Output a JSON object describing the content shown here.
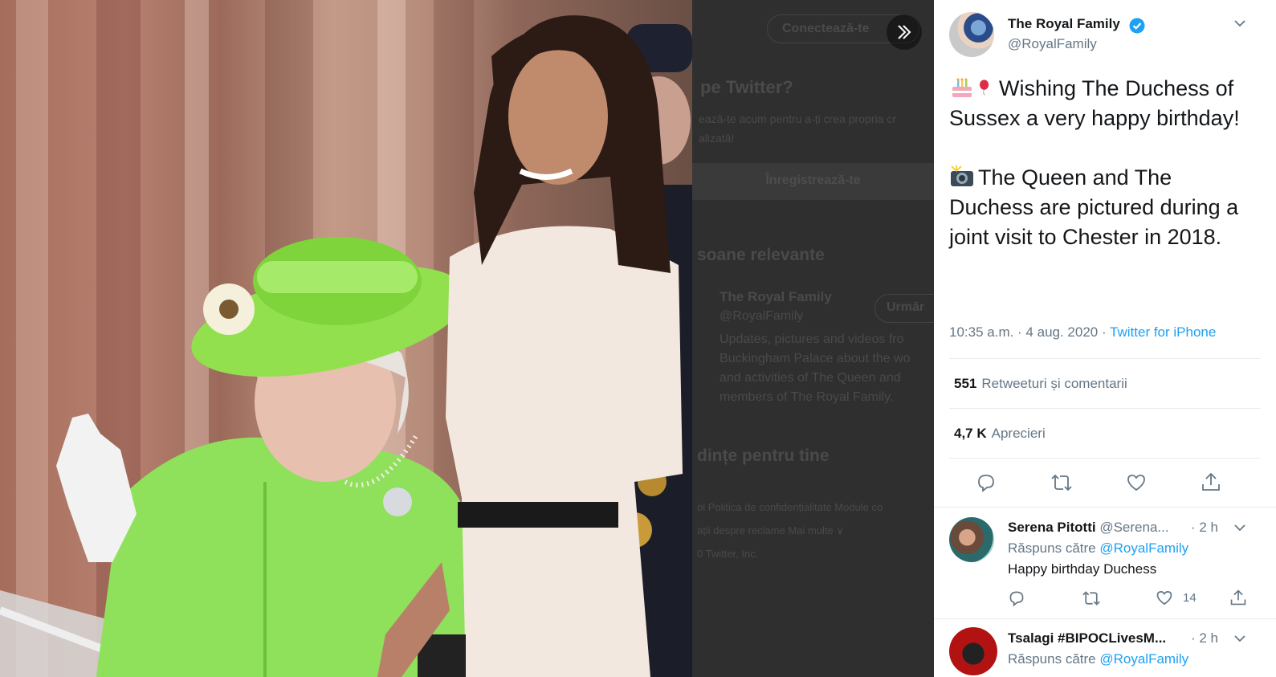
{
  "overlay": {
    "login_button": "Conectează-te",
    "new_to_twitter": "pe Twitter?",
    "signup_blurb_1": "ează-te acum pentru a-ți crea propria cr",
    "signup_blurb_2": "alizată!",
    "signup_button": "Înregistrează-te",
    "relevant_people": "soane relevante",
    "suggest_name": "The Royal Family",
    "suggest_handle": "@RoyalFamily",
    "follow_button": "Urmăr",
    "bio_1": "Updates, pictures and videos fro",
    "bio_2": "Buckingham Palace about the wo",
    "bio_3": "and activities of The Queen and",
    "bio_4": "members of The Royal Family.",
    "trends": "dințe pentru tine",
    "footer_1": "ol   Politica de confidențialitate   Module co",
    "footer_2": "ații despre reclame   Mai multe ∨",
    "footer_3": "0 Twitter, Inc."
  },
  "tweet": {
    "author_name": "The Royal Family",
    "author_handle": "@RoyalFamily",
    "line1": "Wishing The Duchess of Sussex a very happy birthday!",
    "line2": "The Queen and The Duchess are pictured during a joint visit to Chester in 2018.",
    "time": "10:35 a.m. · 4 aug. 2020 · ",
    "source": "Twitter for iPhone",
    "retweets_count": "551",
    "retweets_label": "Retweeturi și comentarii",
    "likes_count": "4,7 K",
    "likes_label": "Aprecieri"
  },
  "replies": [
    {
      "name": "Serena Pitotti",
      "handle": "@Serena...",
      "time": "· 2 h",
      "reply_to_label": "Răspuns către",
      "reply_to": "@RoyalFamily",
      "body": "Happy birthday Duchess",
      "likes": "14"
    },
    {
      "name": "Tsalagi #BIPOCLivesM...",
      "handle": "",
      "time": "· 2 h",
      "reply_to_label": "Răspuns către",
      "reply_to": "@RoyalFamily"
    }
  ],
  "colors": {
    "accent": "#1da1f2",
    "secondary_text": "#657786",
    "divider": "#e6ecf0"
  }
}
